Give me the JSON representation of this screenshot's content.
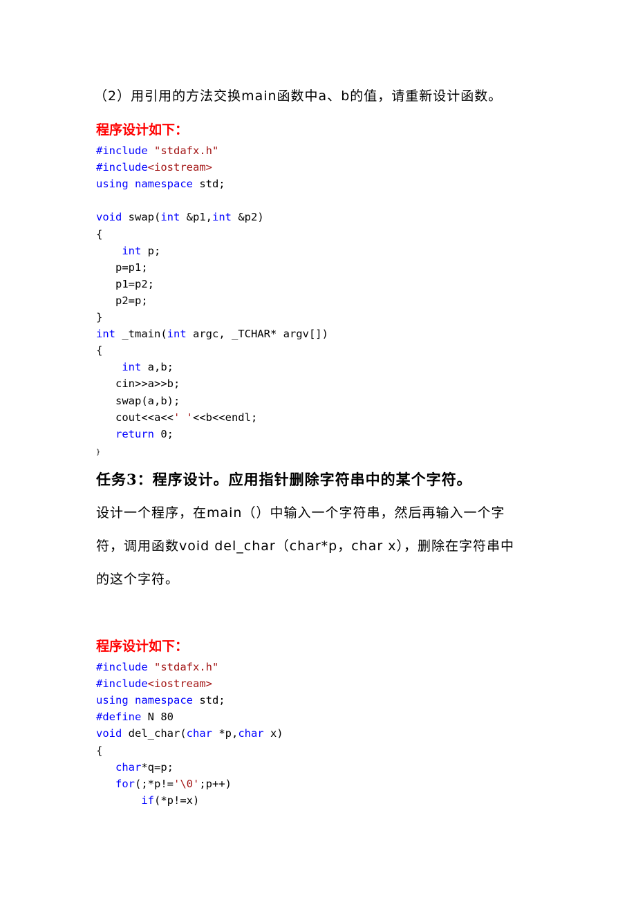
{
  "section2": {
    "intro": "（2）用引用的方法交换main函数中a、b的值，请重新设计函数。",
    "heading": "程序设计如下：",
    "code": [
      [
        {
          "t": "#include ",
          "c": "kw"
        },
        {
          "t": "\"stdafx.h\"",
          "c": "str"
        }
      ],
      [
        {
          "t": "#include",
          "c": "kw"
        },
        {
          "t": "<iostream>",
          "c": "str"
        }
      ],
      [
        {
          "t": "using namespace",
          "c": "kw"
        },
        {
          "t": " std;",
          "c": ""
        }
      ],
      [],
      [
        {
          "t": "void",
          "c": "kw"
        },
        {
          "t": " swap(",
          "c": ""
        },
        {
          "t": "int",
          "c": "kw"
        },
        {
          "t": " &p1,",
          "c": ""
        },
        {
          "t": "int",
          "c": "kw"
        },
        {
          "t": " &p2)",
          "c": ""
        }
      ],
      [
        {
          "t": "{",
          "c": ""
        }
      ],
      [
        {
          "t": "    ",
          "c": ""
        },
        {
          "t": "int",
          "c": "kw"
        },
        {
          "t": " p;",
          "c": ""
        }
      ],
      [
        {
          "t": "   p=p1;",
          "c": ""
        }
      ],
      [
        {
          "t": "   p1=p2;",
          "c": ""
        }
      ],
      [
        {
          "t": "   p2=p;",
          "c": ""
        }
      ],
      [
        {
          "t": "}",
          "c": ""
        }
      ],
      [
        {
          "t": "int",
          "c": "kw"
        },
        {
          "t": " _tmain(",
          "c": ""
        },
        {
          "t": "int",
          "c": "kw"
        },
        {
          "t": " argc, _TCHAR* argv[])",
          "c": ""
        }
      ],
      [
        {
          "t": "{",
          "c": ""
        }
      ],
      [
        {
          "t": "    ",
          "c": ""
        },
        {
          "t": "int",
          "c": "kw"
        },
        {
          "t": " a,b;",
          "c": ""
        }
      ],
      [
        {
          "t": "   cin>>a>>b;",
          "c": ""
        }
      ],
      [
        {
          "t": "   swap(a,b);",
          "c": ""
        }
      ],
      [
        {
          "t": "   cout<<a<<",
          "c": ""
        },
        {
          "t": "' '",
          "c": "str"
        },
        {
          "t": "<<b<<endl;",
          "c": ""
        }
      ],
      [
        {
          "t": "   ",
          "c": ""
        },
        {
          "t": "return",
          "c": "kw"
        },
        {
          "t": " 0;",
          "c": ""
        }
      ],
      [
        {
          "t": "}",
          "c": "small"
        }
      ]
    ]
  },
  "task3": {
    "title": "任务3：程序设计。应用指针删除字符串中的某个字符。",
    "desc_lines": [
      "设计一个程序，在main（）中输入一个字符串，然后再输入一个字",
      "符，调用函数void del_char（char*p，char x），删除在字符串中",
      "的这个字符。"
    ],
    "heading": "程序设计如下：",
    "code": [
      [
        {
          "t": "#include ",
          "c": "kw"
        },
        {
          "t": "\"stdafx.h\"",
          "c": "str"
        }
      ],
      [
        {
          "t": "#include",
          "c": "kw"
        },
        {
          "t": "<iostream>",
          "c": "str"
        }
      ],
      [
        {
          "t": "using namespace",
          "c": "kw"
        },
        {
          "t": " std;",
          "c": ""
        }
      ],
      [
        {
          "t": "#define",
          "c": "kw"
        },
        {
          "t": " N 80",
          "c": ""
        }
      ],
      [
        {
          "t": "void",
          "c": "kw"
        },
        {
          "t": " del_char(",
          "c": ""
        },
        {
          "t": "char",
          "c": "kw"
        },
        {
          "t": " *p,",
          "c": ""
        },
        {
          "t": "char",
          "c": "kw"
        },
        {
          "t": " x)",
          "c": ""
        }
      ],
      [
        {
          "t": "{",
          "c": ""
        }
      ],
      [
        {
          "t": "   ",
          "c": ""
        },
        {
          "t": "char",
          "c": "kw"
        },
        {
          "t": "*q=p;",
          "c": ""
        }
      ],
      [
        {
          "t": "   ",
          "c": ""
        },
        {
          "t": "for",
          "c": "kw"
        },
        {
          "t": "(;*p!=",
          "c": ""
        },
        {
          "t": "'\\0'",
          "c": "str"
        },
        {
          "t": ";p++)",
          "c": ""
        }
      ],
      [
        {
          "t": "       ",
          "c": ""
        },
        {
          "t": "if",
          "c": "kw"
        },
        {
          "t": "(*p!=x)",
          "c": ""
        }
      ]
    ]
  }
}
